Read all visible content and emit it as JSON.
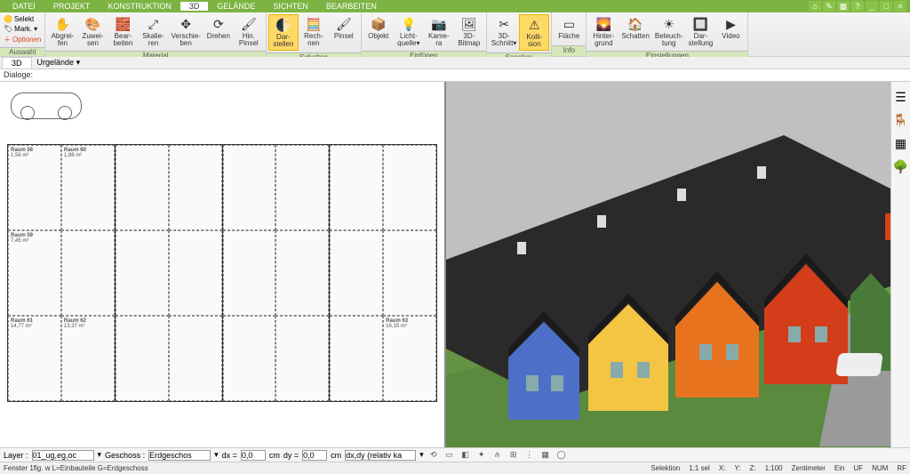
{
  "menu": {
    "items": [
      "DATEI",
      "PROJEKT",
      "KONSTRUKTION",
      "3D",
      "GELÄNDE",
      "SICHTEN",
      "BEARBEITEN"
    ],
    "active_index": 3
  },
  "ribbon": {
    "selekt": {
      "selekt": "Selekt",
      "mark": "Mark.",
      "optionen": "Optionen"
    },
    "groups": [
      {
        "label": "Material",
        "buttons": [
          {
            "id": "abgreifen",
            "label": "Abgrei-\nfen",
            "icon": "✋"
          },
          {
            "id": "zuweisen",
            "label": "Zuwei-\nsen",
            "icon": "🎨"
          },
          {
            "id": "bearbeiten",
            "label": "Bear-\nbeiten",
            "icon": "🧱"
          },
          {
            "id": "skalieren",
            "label": "Skalie-\nren",
            "icon": "⤢"
          },
          {
            "id": "verschieben",
            "label": "Verschie-\nben",
            "icon": "✥"
          },
          {
            "id": "drehen",
            "label": "Drehen",
            "icon": "⟳"
          },
          {
            "id": "hin-pinsel",
            "label": "Hin.\nPinsel",
            "icon": "🖌"
          }
        ]
      },
      {
        "label": "Schatten",
        "buttons": [
          {
            "id": "darstellen",
            "label": "Dar-\nstellen",
            "icon": "🌓",
            "active": true
          },
          {
            "id": "rechnen",
            "label": "Rech-\nnen",
            "icon": "🧮"
          },
          {
            "id": "pinsel",
            "label": "Pinsel",
            "icon": "🖌"
          }
        ]
      },
      {
        "label": "Einfügen",
        "buttons": [
          {
            "id": "objekt",
            "label": "Objekt",
            "icon": "📦"
          },
          {
            "id": "lichtquelle",
            "label": "Licht-\nquelle▾",
            "icon": "💡"
          },
          {
            "id": "kamera",
            "label": "Kame-\nra",
            "icon": "📷"
          },
          {
            "id": "3d-bitmap",
            "label": "3D-\nBitmap",
            "icon": "🖼"
          }
        ]
      },
      {
        "label": "Sonstige",
        "buttons": [
          {
            "id": "3d-schnitt",
            "label": "3D-\nSchnitt▾",
            "icon": "✂"
          },
          {
            "id": "kollision",
            "label": "Kolli-\nsion",
            "icon": "⚠",
            "active": true
          }
        ]
      },
      {
        "label": "Info",
        "buttons": [
          {
            "id": "flaeche",
            "label": "Fläche",
            "icon": "▭"
          }
        ]
      },
      {
        "label": "Einstellungen",
        "buttons": [
          {
            "id": "hintergrund",
            "label": "Hinter-\ngrund",
            "icon": "🌄"
          },
          {
            "id": "schatten",
            "label": "Schatten",
            "icon": "🏠"
          },
          {
            "id": "beleuchtung",
            "label": "Beleuch-\ntung",
            "icon": "☀"
          },
          {
            "id": "darstellung",
            "label": "Dar-\nstellung",
            "icon": "🔲"
          },
          {
            "id": "video",
            "label": "Video",
            "icon": "▶"
          }
        ]
      }
    ],
    "auswahl_label": "Auswahl"
  },
  "tabs": {
    "tab_3d": "3D",
    "dropdown": "Urgelände",
    "down": "▾"
  },
  "dialogs": {
    "label": "Dialoge:"
  },
  "plan": {
    "rooms": [
      {
        "name": "Raum 58",
        "area": "1,56 m²"
      },
      {
        "name": "Raum 60",
        "area": "1,88 m²"
      },
      {
        "name": "Raum 59",
        "area": "7,45 m²"
      },
      {
        "name": "Raum 61",
        "area": "14,77 m²"
      },
      {
        "name": "Raum 62",
        "area": "13,37 m²"
      },
      {
        "name": "Raum 63",
        "area": "16,15 m²"
      }
    ]
  },
  "side": {
    "layers": "☰",
    "furniture": "🪑",
    "materials": "▦",
    "plants": "🌳"
  },
  "bottombar": {
    "layer_label": "Layer :",
    "layer_value": "01_ug,eg,oc",
    "geschoss_label": "Geschoss :",
    "geschoss_value": "Erdgeschos",
    "dx_label": "dx =",
    "dx_value": "0,0",
    "cm1": "cm",
    "dy_label": "dy =",
    "dy_value": "0,0",
    "cm2": "cm",
    "dxdy_label": "dx,dy (relativ ka",
    "down": "▾"
  },
  "status": {
    "left": "Fenster 1flg. w L=Einbauteile G=Erdgeschoss",
    "selektion": "Selektion",
    "scale": "1:1 sel",
    "x": "X:",
    "y": "Y:",
    "z": "Z:",
    "scale2": "1:100",
    "unit": "Zentimeter",
    "ein": "Ein",
    "uf": "UF",
    "num": "NUM",
    "rf": "RF"
  },
  "colors": {
    "house1": "#4e6fc7",
    "house2": "#f4c542",
    "house3": "#e8731e",
    "house4": "#d43d1a",
    "house5": "#4a7a3a",
    "roof": "#2a2a2a"
  }
}
